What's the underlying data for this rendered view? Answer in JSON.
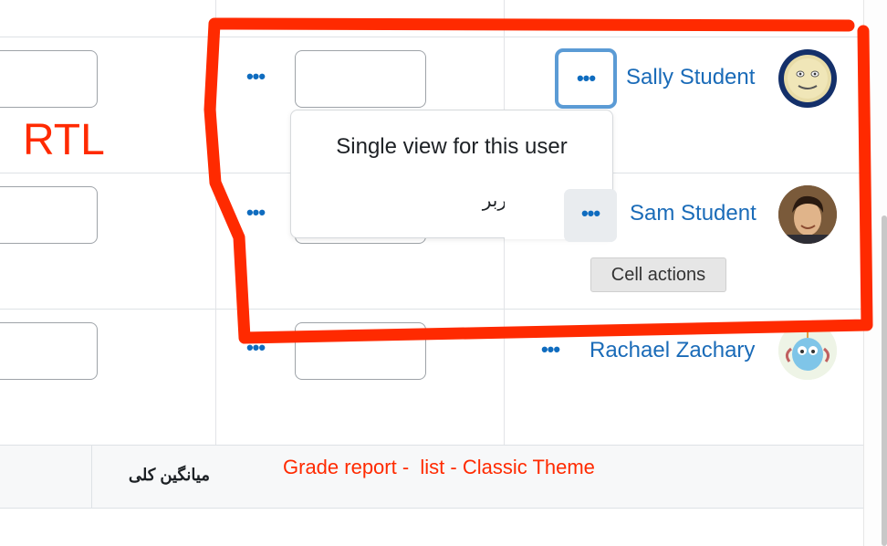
{
  "annotations": {
    "rtl_label": "RTL",
    "caption": "Grade report -  list - Classic Theme",
    "color": "#ff2a00"
  },
  "students": [
    {
      "name": "Sally Student",
      "avatar_icon": "smiley-face-avatar"
    },
    {
      "name": "Sam Student",
      "avatar_icon": "user-photo-avatar"
    },
    {
      "name": "Rachael Zachary",
      "avatar_icon": "monster-avatar"
    }
  ],
  "cell_menu": {
    "single_view": "Single view for this user",
    "partial_rtl_text": "ربر"
  },
  "tooltip": {
    "cell_actions": "Cell actions"
  },
  "footer": {
    "overall_average": "میانگین کلی"
  },
  "actions_glyph": "•••",
  "colors": {
    "link": "#0f6cbf",
    "focus_ring": "#5b9bd5"
  }
}
